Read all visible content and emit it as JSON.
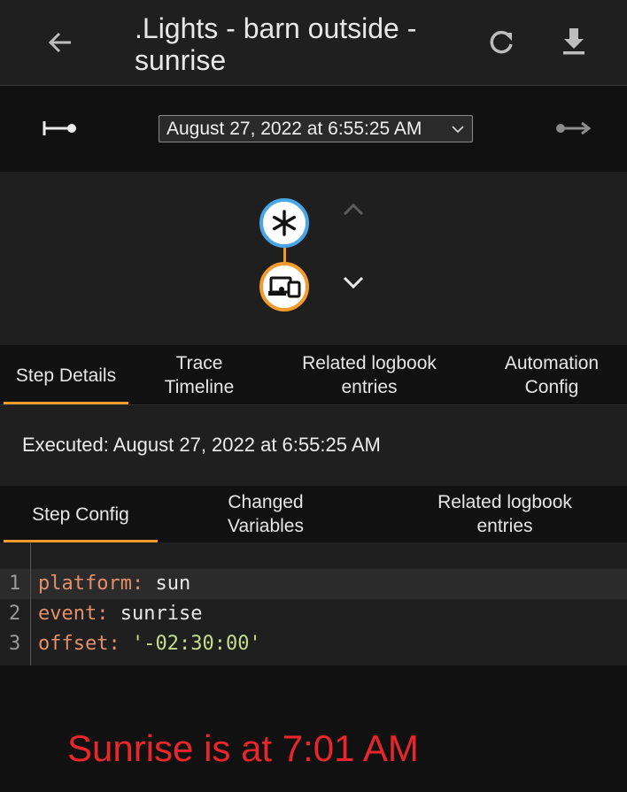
{
  "header": {
    "title": ".Lights - barn outside - sunrise",
    "icons": {
      "back": "arrow-left-icon",
      "refresh": "refresh-icon",
      "download": "download-icon"
    }
  },
  "trace_nav": {
    "selected_trace": "August 27, 2022 at 6:55:25 AM",
    "icons": {
      "prev": "previous-trace-icon",
      "next": "next-trace-icon"
    }
  },
  "graph": {
    "nodes": [
      {
        "type": "trigger",
        "icon": "asterisk-icon",
        "color": "#4aa5e8"
      },
      {
        "type": "action",
        "icon": "devices-icon",
        "color": "#f29a2b"
      }
    ]
  },
  "main_tabs": [
    {
      "label": "Step Details",
      "active": true
    },
    {
      "label": "Trace Timeline",
      "active": false
    },
    {
      "label": "Related logbook entries",
      "active": false
    },
    {
      "label": "Automation Config",
      "active": false
    }
  ],
  "executed": "Executed: August 27, 2022 at 6:55:25 AM",
  "step_tabs": [
    {
      "label": "Step Config",
      "active": true
    },
    {
      "label": "Changed Variables",
      "active": false
    },
    {
      "label": "Related logbook entries",
      "active": false
    }
  ],
  "code": {
    "lines": [
      {
        "num": "1",
        "key": "platform",
        "sep": ": ",
        "value": "sun"
      },
      {
        "num": "2",
        "key": "event",
        "sep": ": ",
        "value": "sunrise"
      },
      {
        "num": "3",
        "key": "offset",
        "sep": ": ",
        "value": "'-02:30:00'"
      }
    ]
  },
  "annotation": "Sunrise is at 7:01 AM",
  "colors": {
    "accent": "#f29a2b",
    "trigger": "#4aa5e8",
    "annotation": "#e8262b"
  }
}
